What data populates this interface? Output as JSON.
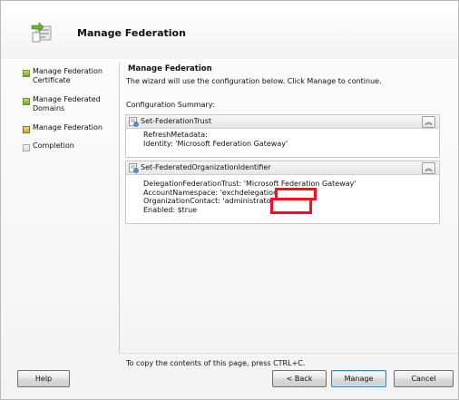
{
  "window": {
    "title": "Manage Federation"
  },
  "steps": [
    {
      "label": "Manage Federation Certificate",
      "state": "done"
    },
    {
      "label": "Manage Federated Domains",
      "state": "done"
    },
    {
      "label": "Manage Federation",
      "state": "current"
    },
    {
      "label": "Completion",
      "state": "pending"
    }
  ],
  "content": {
    "title": "Manage Federation",
    "description": "The wizard will use the configuration below.  Click Manage to continue.",
    "summary_label": "Configuration Summary:"
  },
  "panels": [
    {
      "title": "Set-FederationTrust",
      "lines": [
        "RefreshMetadata:",
        "Identity: 'Microsoft Federation Gateway'"
      ]
    },
    {
      "title": "Set-FederatedOrganizationIdentifier",
      "lines": [
        "DelegationFederationTrust: 'Microsoft Federation Gateway'",
        "AccountNamespace: 'exchdelegation.                          .com'",
        "OrganizationContact: 'administrator@                          .com'",
        "Enabled: $true"
      ]
    }
  ],
  "footer": {
    "hint": "To copy the contents of this page, press CTRL+C."
  },
  "buttons": {
    "help": "Help",
    "back": "< Back",
    "manage": "Manage",
    "cancel": "Cancel"
  },
  "icons": {
    "header": "wizard-federation-icon",
    "panel": "cmdlet-icon",
    "collapse": "double-chevron-up-icon"
  },
  "colors": {
    "step_done": "#6faa1f",
    "step_current": "#d7a32c",
    "redaction": "#ff0b1f"
  }
}
